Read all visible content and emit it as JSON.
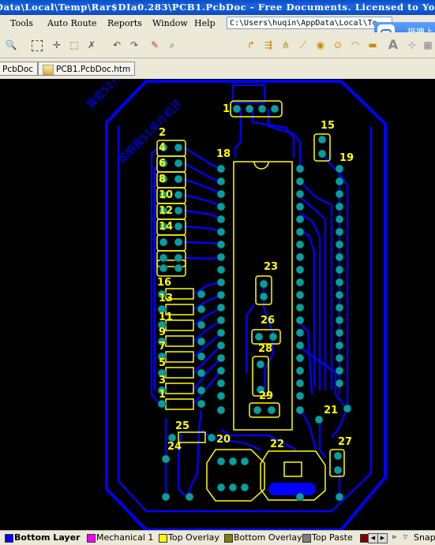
{
  "window": {
    "title": "Data\\Local\\Temp\\Rar$DIa0.283\\PCB1.PcbDoc - Free Documents. Licensed to Your Name"
  },
  "menu": {
    "items": [
      "Tools",
      "Auto Route",
      "Reports",
      "Window",
      "Help"
    ],
    "path": "C:\\Users\\huqin\\AppData\\Local\\Te",
    "upload_label": "拖拽上"
  },
  "tabs": [
    {
      "label": "PcbDoc"
    },
    {
      "label": "PCB1.PcbDoc.htm"
    }
  ],
  "board": {
    "silk_text": {
      "top_left_1": "我爱51开",
      "top_left_2": "聪明我51单片机开",
      "d1": "1",
      "d2": "2",
      "d4": "4",
      "d6": "6",
      "d8": "8",
      "d10": "10",
      "d12": "12",
      "d14": "14",
      "d16": "16",
      "d13": "13",
      "d11": "11",
      "d9": "9",
      "d7": "7",
      "d5": "5",
      "d3": "3",
      "d1b": "1",
      "d15": "15",
      "d17": "17",
      "d18": "18",
      "d19": "19",
      "d20": "20",
      "d21": "21",
      "d22": "22",
      "d23": "23",
      "d24": "24",
      "d25": "25",
      "d26": "26",
      "d27": "27",
      "d28": "28",
      "d29": "29"
    }
  },
  "status": {
    "layers": [
      {
        "label": "Bottom Layer",
        "color": "#0000ff",
        "active": true
      },
      {
        "label": "Mechanical 1",
        "color": "#ff00ff",
        "active": false
      },
      {
        "label": "Top Overlay",
        "color": "#ffff00",
        "active": false
      },
      {
        "label": "Bottom Overlay",
        "color": "#808000",
        "active": false
      },
      {
        "label": "Top Paste",
        "color": "#808080",
        "active": false
      },
      {
        "label": "",
        "color": "#800000",
        "active": false
      }
    ],
    "snap_label": "Snap"
  },
  "colors": {
    "trace": "#0000ff",
    "silk": "#ffff00",
    "pad": "#00a0a0",
    "board_bg": "#000000"
  }
}
